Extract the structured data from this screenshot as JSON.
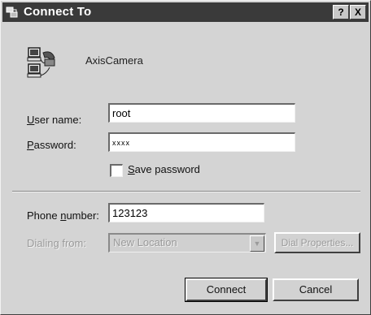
{
  "window": {
    "title": "Connect To",
    "help_glyph": "?",
    "close_glyph": "X"
  },
  "connection": {
    "name": "AxisCamera",
    "icon": "computer-phone-icon"
  },
  "form": {
    "user_label": "User name:",
    "user_value": "root",
    "password_label": "Password:",
    "password_value": "xxxx",
    "save_password_label": "Save password",
    "save_password_checked": false,
    "phone_label": "Phone number:",
    "phone_value": "123123",
    "dialing_from_label": "Dialing from:",
    "dialing_from_value": "New Location",
    "dial_properties_label": "Dial Properties..."
  },
  "buttons": {
    "connect_label": "Connect",
    "cancel_label": "Cancel"
  },
  "colors": {
    "titlebar": "#3a3a3a",
    "dialog_face": "#d4d4d4",
    "disabled_text": "#9a9a9a"
  }
}
